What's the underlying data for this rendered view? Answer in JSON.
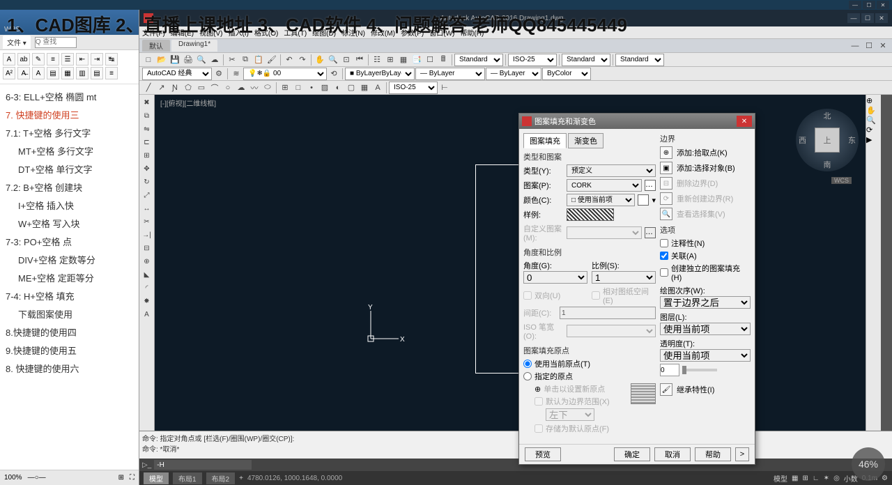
{
  "overlay": "1、CAD图库 2、直播上课地址 3、CAD软件 4、问题解答 老师QQ845445449",
  "wps": {
    "app": "WPS",
    "fileMenu": "文件 ▾",
    "searchPlaceholder": "Q 查找",
    "zoom": "100%",
    "outline": [
      {
        "t": "6-3:  ELL+空格  椭圆 mt",
        "cls": ""
      },
      {
        "t": "7. 快捷键的使用三",
        "cls": "active"
      },
      {
        "t": "7.1:  T+空格  多行文字",
        "cls": ""
      },
      {
        "t": "MT+空格  多行文字",
        "cls": "sub"
      },
      {
        "t": "DT+空格  单行文字",
        "cls": "sub"
      },
      {
        "t": "7.2: B+空格  创建块",
        "cls": ""
      },
      {
        "t": "I+空格  插入快",
        "cls": "sub"
      },
      {
        "t": "W+空格  写入块",
        "cls": "sub"
      },
      {
        "t": "7-3:  PO+空格  点",
        "cls": ""
      },
      {
        "t": "DIV+空格  定数等分",
        "cls": "sub"
      },
      {
        "t": "ME+空格  定距等分",
        "cls": "sub"
      },
      {
        "t": "7-4:  H+空格  填充",
        "cls": ""
      },
      {
        "t": "下载图案使用",
        "cls": "sub"
      },
      {
        "t": "8.快捷键的使用四",
        "cls": ""
      },
      {
        "t": "9.快捷键的使用五",
        "cls": ""
      },
      {
        "t": "8. 快捷键的使用六",
        "cls": ""
      }
    ]
  },
  "cad": {
    "titleCenter": "Autodesk AutoCAD 2016    Drawing1.dwg",
    "menu": [
      "文件(F)",
      "编辑(E)",
      "视图(V)",
      "插入(I)",
      "格式(O)",
      "工具(T)",
      "绘图(D)",
      "标注(N)",
      "修改(M)",
      "参数(P)",
      "窗口(W)",
      "帮助(H)"
    ],
    "tabs": [
      "默认",
      "Drawing1*"
    ],
    "workspace": "AutoCAD 经典",
    "layerState": "0",
    "selects": {
      "standard1": "Standard",
      "iso25": "ISO-25",
      "standard2": "Standard",
      "standard3": "Standard",
      "bylayer1": "ByLayer",
      "bylayer2": "ByLayer",
      "bylayer3": "ByLayer",
      "bycolor": "ByColor",
      "iso25b": "ISO-25"
    },
    "viewLabel": "[-][俯视][二维线框]",
    "cube": {
      "n": "北",
      "s": "南",
      "e": "东",
      "w": "西",
      "face": "上",
      "wcs": "WCS"
    },
    "cmd1": "命令: 指定对角点或 [栏选(F)/圈围(WP)/圈交(CP)]:",
    "cmd2": "命令: *取消*",
    "cmdInput": "-H",
    "status": {
      "tabs": [
        "模型",
        "布局1",
        "布局2"
      ],
      "coords": "4780.0126, 1000.1648, 0.0000",
      "model": "模型",
      "smallMode": "小数",
      "pct": "46%",
      "scale": "0.1m"
    }
  },
  "dlg": {
    "title": "图案填充和渐变色",
    "tabs": [
      "图案填充",
      "渐变色"
    ],
    "grp_type": "类型和图案",
    "lbl_type": "类型(Y):",
    "val_type": "预定义",
    "lbl_pattern": "图案(P):",
    "val_pattern": "CORK",
    "lbl_color": "颜色(C):",
    "val_color": "□ 使用当前项",
    "lbl_sample": "样例:",
    "lbl_custom": "自定义图案(M):",
    "grp_angle": "角度和比例",
    "lbl_angle": "角度(G):",
    "val_angle": "0",
    "lbl_scale": "比例(S):",
    "val_scale": "1",
    "chk_double": "双向(U)",
    "chk_relpaper": "相对图纸空间(E)",
    "lbl_spacing": "间距(C):",
    "val_spacing": "1",
    "lbl_isopen": "ISO 笔宽(O):",
    "grp_origin": "图案填充原点",
    "r_useorigin": "使用当前原点(T)",
    "r_specified": "指定的原点",
    "btn_clickset": "单击以设置新原点",
    "chk_default": "默认为边界范围(X)",
    "sel_pos": "左下",
    "chk_store": "存储为默认原点(F)",
    "grp_boundary": "边界",
    "b_pick": "添加:拾取点(K)",
    "b_select": "添加:选择对象(B)",
    "b_remove": "删除边界(D)",
    "b_recreate": "重新创建边界(R)",
    "b_viewsel": "查看选择集(V)",
    "grp_options": "选项",
    "chk_annot": "注释性(N)",
    "chk_assoc": "关联(A)",
    "chk_separate": "创建独立的图案填充(H)",
    "lbl_draworder": "绘图次序(W):",
    "val_draworder": "置于边界之后",
    "lbl_layer": "图层(L):",
    "val_layer": "使用当前项",
    "lbl_trans": "透明度(T):",
    "val_trans": "使用当前项",
    "val_transnum": "0",
    "b_inherit": "继承特性(I)",
    "btn_preview": "预览",
    "btn_ok": "确定",
    "btn_cancel": "取消",
    "btn_help": "帮助",
    "arrow": ">"
  }
}
